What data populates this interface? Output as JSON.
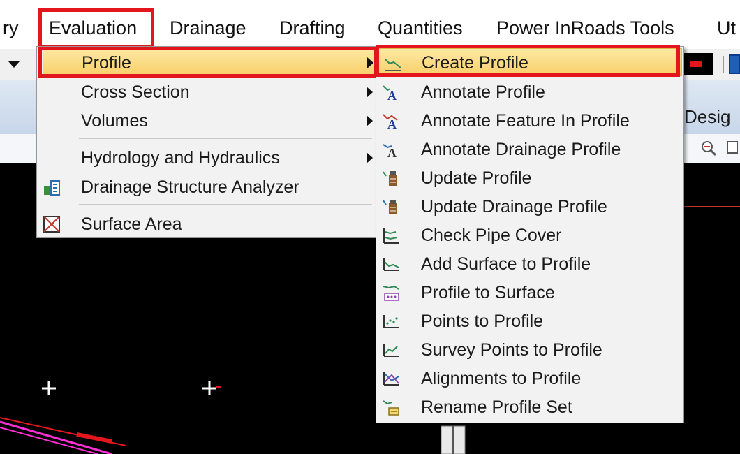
{
  "menubar": {
    "items": [
      {
        "label": "ry"
      },
      {
        "label": "Evaluation"
      },
      {
        "label": "Drainage"
      },
      {
        "label": "Drafting"
      },
      {
        "label": "Quantities"
      },
      {
        "label": "Power InRoads Tools"
      },
      {
        "label": "Ut"
      }
    ]
  },
  "ribbon": {
    "tab_partial": "Desig"
  },
  "evaluation_menu": {
    "items": [
      {
        "label": "Profile"
      },
      {
        "label": "Cross Section"
      },
      {
        "label": "Volumes"
      },
      {
        "label": "Hydrology and Hydraulics"
      },
      {
        "label": "Drainage Structure Analyzer"
      },
      {
        "label": "Surface Area"
      }
    ]
  },
  "profile_submenu": {
    "items": [
      {
        "label": "Create Profile"
      },
      {
        "label": "Annotate Profile"
      },
      {
        "label": "Annotate Feature In Profile"
      },
      {
        "label": "Annotate Drainage Profile"
      },
      {
        "label": "Update Profile"
      },
      {
        "label": "Update Drainage Profile"
      },
      {
        "label": "Check Pipe Cover"
      },
      {
        "label": "Add Surface to Profile"
      },
      {
        "label": "Profile to Surface"
      },
      {
        "label": "Points to Profile"
      },
      {
        "label": "Survey Points to Profile"
      },
      {
        "label": "Alignments to Profile"
      },
      {
        "label": "Rename Profile Set"
      }
    ]
  },
  "colors": {
    "highlight_border": "#e3161d",
    "selection": "#f9cf6a"
  }
}
